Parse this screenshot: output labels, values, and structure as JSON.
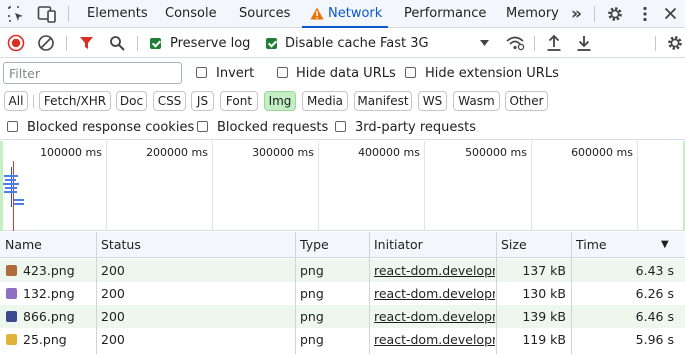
{
  "tabs": [
    {
      "label": "Elements",
      "active": false
    },
    {
      "label": "Console",
      "active": false
    },
    {
      "label": "Sources",
      "active": false
    },
    {
      "label": "Network",
      "active": true
    },
    {
      "label": "Performance",
      "active": false
    },
    {
      "label": "Memory",
      "active": false
    }
  ],
  "tabbar_icons": [
    "inspect-element-icon",
    "device-toolbar-icon",
    "warning-icon",
    "more-tabs-icon",
    "settings-gear-icon",
    "kebab-menu-icon",
    "close-icon"
  ],
  "more_tabs_glyph": "»",
  "toolbar": {
    "icons": [
      "record-stop-icon",
      "clear-icon",
      "filter-funnel-icon",
      "search-icon",
      "network-conditions-icon",
      "import-har-icon",
      "export-har-icon",
      "network-settings-gear-icon"
    ],
    "preserve_log": {
      "label": "Preserve log",
      "checked": true
    },
    "disable_cache": {
      "label": "Disable cache",
      "checked": true
    },
    "throttling": {
      "value": "Fast 3G"
    }
  },
  "filter": {
    "value": "",
    "placeholder": "Filter",
    "invert": {
      "label": "Invert",
      "checked": false
    },
    "hide_data_urls": {
      "label": "Hide data URLs",
      "checked": false
    },
    "hide_extension_urls": {
      "label": "Hide extension URLs",
      "checked": false
    }
  },
  "type_filters": [
    {
      "label": "All",
      "active": false
    },
    {
      "label": "Fetch/XHR",
      "active": false
    },
    {
      "label": "Doc",
      "active": false
    },
    {
      "label": "CSS",
      "active": false
    },
    {
      "label": "JS",
      "active": false
    },
    {
      "label": "Font",
      "active": false
    },
    {
      "label": "Img",
      "active": true
    },
    {
      "label": "Media",
      "active": false
    },
    {
      "label": "Manifest",
      "active": false
    },
    {
      "label": "WS",
      "active": false
    },
    {
      "label": "Wasm",
      "active": false
    },
    {
      "label": "Other",
      "active": false
    }
  ],
  "blocked": {
    "blocked_response_cookies": {
      "label": "Blocked response cookies",
      "checked": false
    },
    "blocked_requests": {
      "label": "Blocked requests",
      "checked": false
    },
    "third_party_requests": {
      "label": "3rd-party requests",
      "checked": false
    }
  },
  "overview": {
    "ticks": [
      "100000 ms",
      "200000 ms",
      "300000 ms",
      "400000 ms",
      "500000 ms",
      "600000 ms"
    ],
    "colors": {
      "request_bar": "#4a7ee8",
      "marker_red": "#e53935",
      "marker_blue": "#1a56db"
    }
  },
  "table": {
    "columns": [
      "Name",
      "Status",
      "Type",
      "Initiator",
      "Size",
      "Time"
    ],
    "sort_indicator": "▼",
    "rows": [
      {
        "name": "423.png",
        "status": "200",
        "type": "png",
        "initiator": "react-dom.developme",
        "size": "137 kB",
        "time": "6.43 s",
        "icon_color": "#b06a3b"
      },
      {
        "name": "132.png",
        "status": "200",
        "type": "png",
        "initiator": "react-dom.developme",
        "size": "130 kB",
        "time": "6.26 s",
        "icon_color": "#8e6fc2"
      },
      {
        "name": "866.png",
        "status": "200",
        "type": "png",
        "initiator": "react-dom.developme",
        "size": "139 kB",
        "time": "6.46 s",
        "icon_color": "#3b4a8f"
      },
      {
        "name": "25.png",
        "status": "200",
        "type": "png",
        "initiator": "react-dom.developme",
        "size": "119 kB",
        "time": "5.96 s",
        "icon_color": "#e2b23a"
      }
    ]
  },
  "colors": {
    "accent_blue": "#0b57d0",
    "checkbox_green": "#1e7e34",
    "active_chip": "#c2f0c2",
    "warning_orange": "#e8710a",
    "funnel_red": "#d93025",
    "row_stripe": "#eef7ee"
  }
}
